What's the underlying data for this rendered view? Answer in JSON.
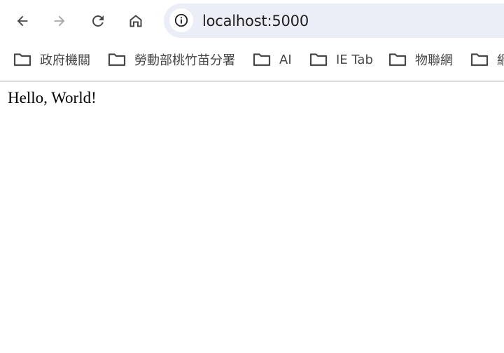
{
  "toolbar": {
    "back_icon": "arrow-left-icon",
    "forward_icon": "arrow-right-icon",
    "reload_icon": "reload-icon",
    "home_icon": "home-icon",
    "omnibox": {
      "site_info_icon": "info-icon",
      "url": "localhost:5000"
    }
  },
  "bookmarks": {
    "items": [
      {
        "label": "政府機關",
        "icon": "folder-icon"
      },
      {
        "label": "勞動部桃竹苗分署",
        "icon": "folder-icon"
      },
      {
        "label": "AI",
        "icon": "folder-icon"
      },
      {
        "label": "IE Tab",
        "icon": "folder-icon"
      },
      {
        "label": "物聯網",
        "icon": "folder-icon"
      },
      {
        "label": "網",
        "icon": "folder-icon"
      }
    ]
  },
  "page": {
    "body_text": "Hello, World!"
  },
  "colors": {
    "omnibox_bg": "#eceef7",
    "icon_active": "#474747",
    "icon_disabled": "#a6a6a6",
    "divider": "#dadce0"
  }
}
